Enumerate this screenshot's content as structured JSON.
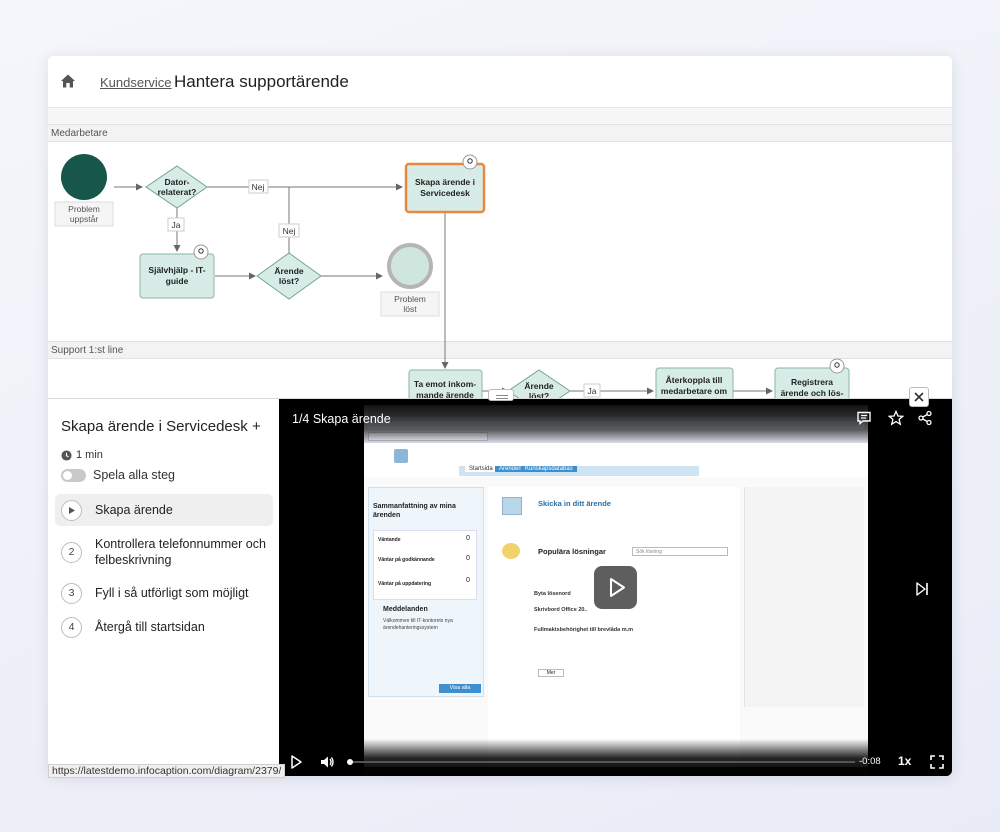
{
  "header": {
    "breadcrumb_link": "Kundservice",
    "title": "Hantera supportärende"
  },
  "diagram": {
    "lanes": [
      "Medarbetare",
      "Support 1:st line"
    ],
    "nodes": {
      "start_event": "Problem uppstår",
      "gateway_dator": "Dator-relaterat?",
      "task_sjalvhjalp": "Självhjälp - IT-guide",
      "gateway_arende": "Ärende löst?",
      "end_event": "Problem löst",
      "task_skapa": "Skapa ärende i Servicedesk",
      "task_ta_emot": "Ta emot inkommande ärende",
      "gateway_lost": "Ärende löst?",
      "task_aterkoppla": "Återkoppla till medarbetare om att man support",
      "task_registrera": "Registrera ärende och lös-"
    },
    "flow_labels": {
      "nej_1": "Nej",
      "ja_1": "Ja",
      "nej_2": "Nej",
      "ja_2": "Ja"
    }
  },
  "panel": {
    "title": "Skapa ärende i Servicedesk +",
    "duration": "1 min",
    "play_all_label": "Spela alla steg",
    "steps": [
      {
        "num": "1",
        "label": "Skapa ärende"
      },
      {
        "num": "2",
        "label": "Kontrollera telefonnummer och felbeskrivning"
      },
      {
        "num": "3",
        "label": "Fyll i så utförligt som möjligt"
      },
      {
        "num": "4",
        "label": "Återgå till startsidan"
      }
    ]
  },
  "player": {
    "title": "1/4 Skapa ärende",
    "time_remaining": "-0:08",
    "speed": "1x",
    "progress": 0.0,
    "screenshot": {
      "tabs": [
        "Startsida",
        "Ärenden",
        "Kunskapsdatabas"
      ],
      "summary_title": "Sammanfattning av mina ärenden",
      "summary_rows": [
        {
          "label": "Väntande",
          "value": "0"
        },
        {
          "label": "Väntar på godkännande",
          "value": "0"
        },
        {
          "label": "Väntar på uppdatering",
          "value": "0"
        }
      ],
      "messages_title": "Meddelanden",
      "messages_lines": [
        "Välkommen till IT-kontorets nya ärendehanteringssystem"
      ],
      "show_all": "Visa alla",
      "submit_title": "Skicka in ditt ärende",
      "popular_title": "Populära lösningar",
      "search_placeholder": "Sök lösning",
      "solutions": [
        "Byta lösenord",
        "Skrivbord Office 20..",
        "Fullmaktsbehörighet till brevlåda m.m"
      ],
      "more": "Mer"
    }
  },
  "status_url": "https://latestdemo.infocaption.com/diagram/2379/"
}
